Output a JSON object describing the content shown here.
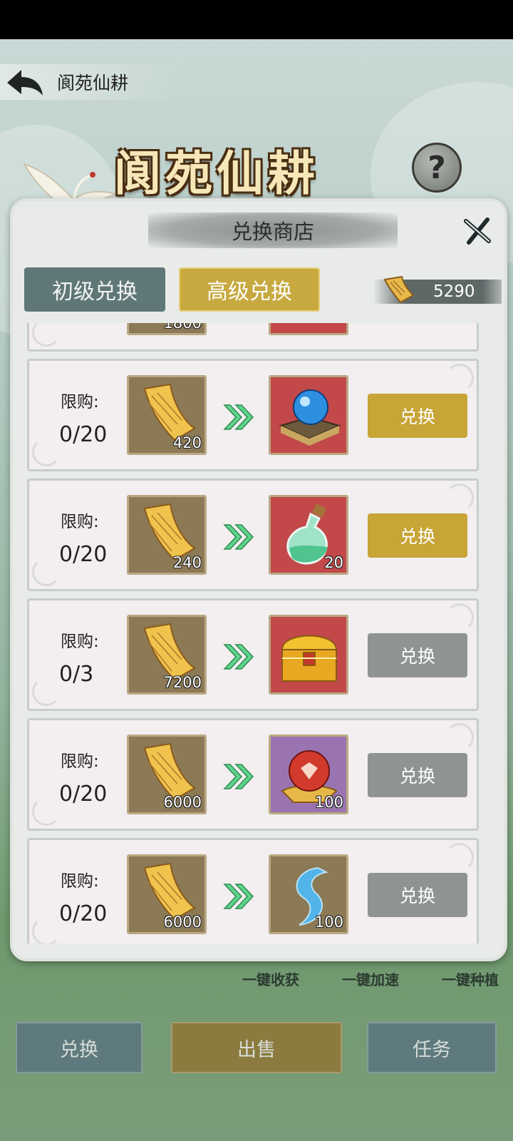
{
  "app": {
    "title": "阆苑仙耕",
    "banner_title": "阆苑仙耕",
    "help": "?"
  },
  "shop": {
    "title": "兑换商店",
    "tabs": [
      {
        "label": "初级兑换",
        "active": false
      },
      {
        "label": "高级兑换",
        "active": true
      }
    ],
    "currency_amount": "5290",
    "partial_top_row": {
      "cost": "1800"
    },
    "items": [
      {
        "limit_label": "限购:",
        "limit": "0/20",
        "cost": "420",
        "reward": "blue-orb-pedestal",
        "reward_qty": "",
        "button": "兑换",
        "enabled": true,
        "bg": "red"
      },
      {
        "limit_label": "限购:",
        "limit": "0/20",
        "cost": "240",
        "reward": "green-potion",
        "reward_qty": "20",
        "button": "兑换",
        "enabled": true,
        "bg": "red"
      },
      {
        "limit_label": "限购:",
        "limit": "0/3",
        "cost": "7200",
        "reward": "golden-chest",
        "reward_qty": "",
        "button": "兑换",
        "enabled": false,
        "bg": "red"
      },
      {
        "limit_label": "限购:",
        "limit": "0/20",
        "cost": "6000",
        "reward": "red-orb",
        "reward_qty": "100",
        "button": "兑换",
        "enabled": false,
        "bg": "purple"
      },
      {
        "limit_label": "限购:",
        "limit": "0/20",
        "cost": "6000",
        "reward": "blue-spirit",
        "reward_qty": "100",
        "button": "兑换",
        "enabled": false,
        "bg": "brown"
      }
    ]
  },
  "footer": {
    "links": [
      "一键收获",
      "一键加速",
      "一键种植"
    ],
    "buttons": {
      "exchange": "兑换",
      "sell": "出售",
      "task": "任务"
    }
  }
}
